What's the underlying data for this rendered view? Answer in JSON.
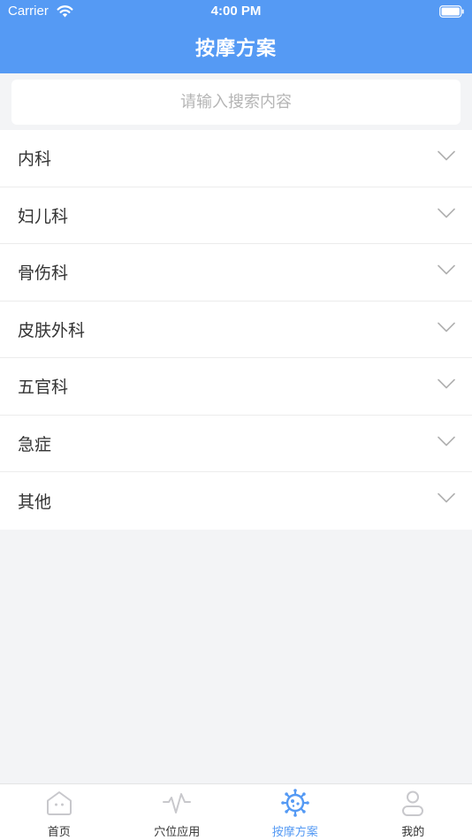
{
  "status_bar": {
    "carrier": "Carrier",
    "time": "4:00 PM"
  },
  "header": {
    "title": "按摩方案"
  },
  "search": {
    "placeholder": "请输入搜索内容",
    "value": ""
  },
  "categories": [
    {
      "label": "内科",
      "icon": "chevron-down-icon"
    },
    {
      "label": "妇儿科",
      "icon": "chevron-down-icon"
    },
    {
      "label": "骨伤科",
      "icon": "chevron-down-icon"
    },
    {
      "label": "皮肤外科",
      "icon": "chevron-down-icon"
    },
    {
      "label": "五官科",
      "icon": "chevron-down-icon"
    },
    {
      "label": "急症",
      "icon": "chevron-down-icon"
    },
    {
      "label": "其他",
      "icon": "chevron-down-icon"
    }
  ],
  "tabbar": {
    "active_index": 2,
    "tabs": [
      {
        "label": "首页",
        "icon": "home-icon"
      },
      {
        "label": "穴位应用",
        "icon": "pulse-icon"
      },
      {
        "label": "按摩方案",
        "icon": "virus-icon"
      },
      {
        "label": "我的",
        "icon": "user-icon"
      }
    ]
  },
  "colors": {
    "primary": "#559af4",
    "background": "#f3f4f6",
    "text": "#333333",
    "chevron": "#b0b0b0",
    "inactive_icon": "#c8c8cc"
  }
}
